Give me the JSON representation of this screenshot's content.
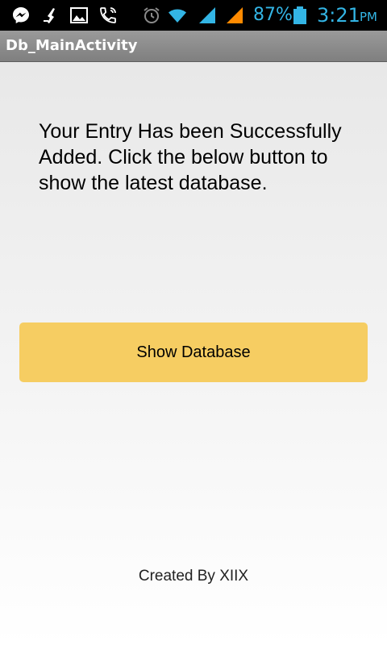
{
  "status_bar": {
    "battery_percent": "87%",
    "time": "3:21",
    "ampm": "PM",
    "icons_left": [
      "messenger-icon",
      "cleaner-icon",
      "gallery-icon",
      "phone-call-icon"
    ],
    "icons_right": [
      "alarm-icon",
      "wifi-icon",
      "signal-blue-icon",
      "signal-orange-icon",
      "battery-icon"
    ],
    "accent_color": "#33b5e5"
  },
  "action_bar": {
    "title": "Db_MainActivity"
  },
  "main": {
    "message": "Your Entry Has been Successfully Added. Click the below button to show the latest database.",
    "button_label": "Show Database",
    "button_color": "#f6cd62",
    "footer": "Created By XIIX"
  }
}
